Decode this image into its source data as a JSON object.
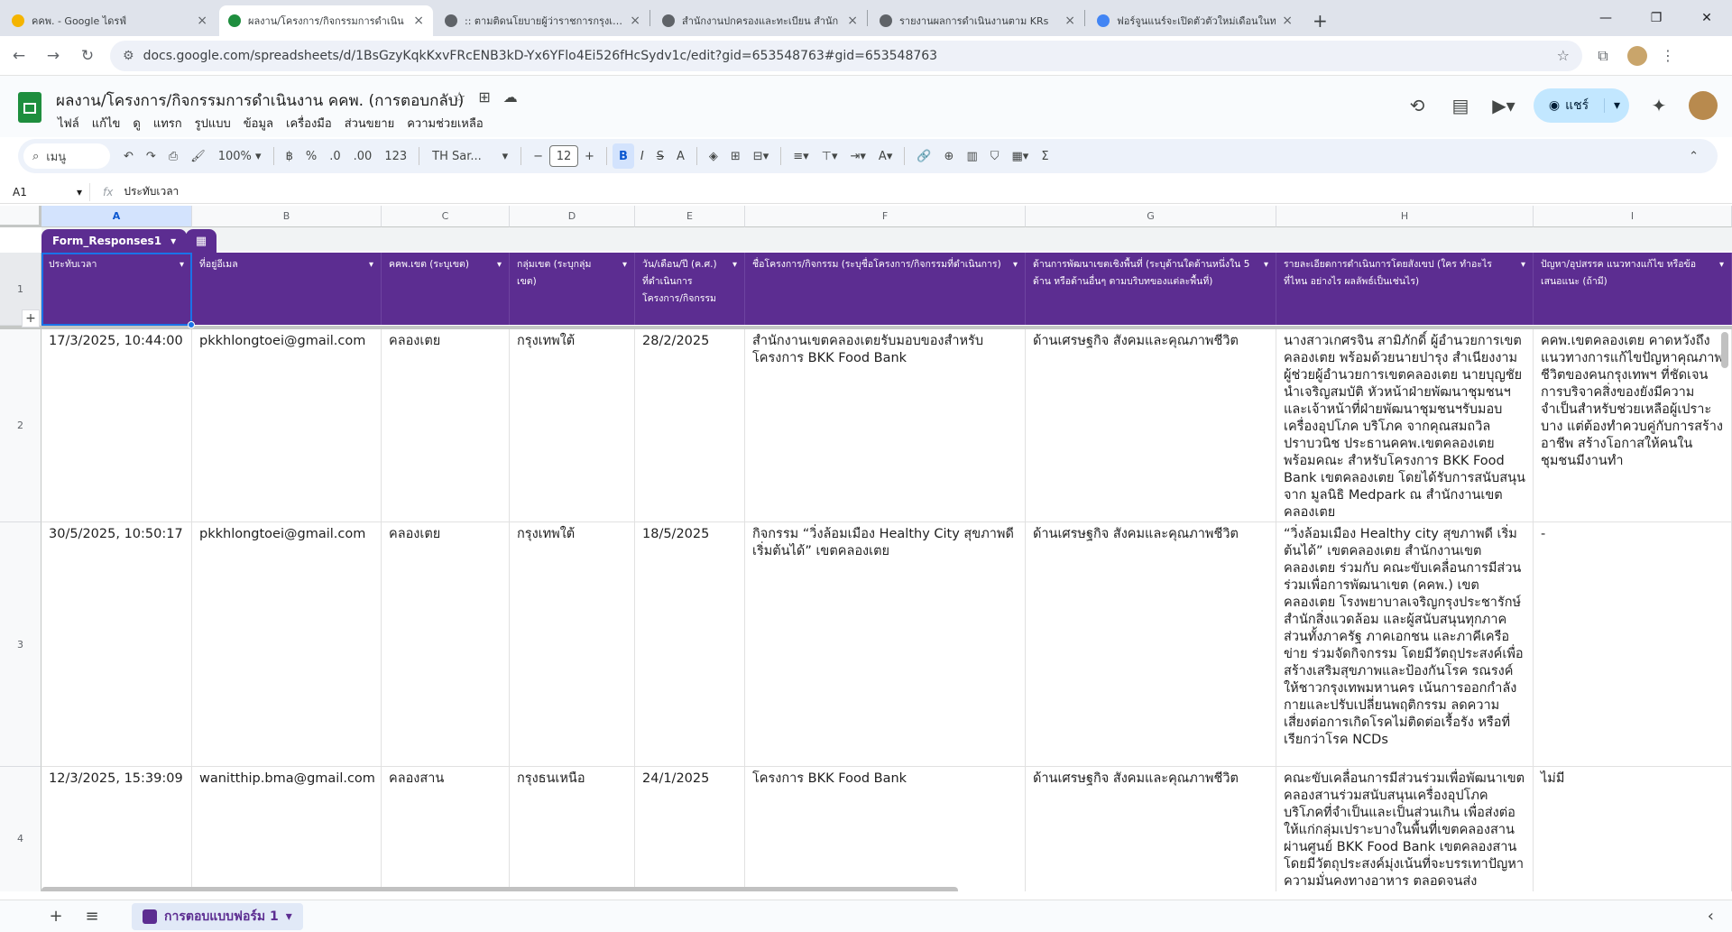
{
  "browser": {
    "tabs": [
      {
        "title": "คคพ. - Google ไดรฟ์",
        "color": "#f4b400"
      },
      {
        "title": "ผลงาน/โครงการ/กิจกรรมการดำเนิน",
        "color": "#1e8e3e"
      },
      {
        "title": ":: ตามติดนโยบายผู้ว่าราชการกรุงเทพ",
        "color": "#5f6368"
      },
      {
        "title": "สำนักงานปกครองและทะเบียน สำนัก",
        "color": "#5f6368"
      },
      {
        "title": "รายงานผลการดำเนินงานตาม KRs",
        "color": "#5f6368"
      },
      {
        "title": "ฟอร์จูนแนร์จะเปิดตัวตัวใหม่เดือนในท",
        "color": "#4285f4"
      }
    ],
    "url": "docs.google.com/spreadsheets/d/1BsGzyKqkKxvFRcENB3kD-Yx6YFlo4Ei526fHcSydv1c/edit?gid=653548763#gid=653548763"
  },
  "doc": {
    "title": "ผลงาน/โครงการ/กิจกรรมการดำเนินงาน คคพ. (การตอบกลับ)",
    "menu": [
      "ไฟล์",
      "แก้ไข",
      "ดู",
      "แทรก",
      "รูปแบบ",
      "ข้อมูล",
      "เครื่องมือ",
      "ส่วนขยาย",
      "ความช่วยเหลือ"
    ],
    "share_label": "แชร์"
  },
  "toolbar": {
    "search_label": "เมนู",
    "zoom": "100%",
    "pct": "%",
    "dec_less": ".0",
    "dec_more": ".00",
    "num_fmt": "123",
    "font": "TH Sar...",
    "font_size": "12"
  },
  "formula": {
    "cell_ref": "A1",
    "fx": "fx",
    "content": "ประทับเวลา"
  },
  "grid": {
    "columns": [
      "A",
      "B",
      "C",
      "D",
      "E",
      "F",
      "G",
      "H",
      "I"
    ],
    "table_name": "Form_Responses1",
    "headers": [
      "ประทับเวลา",
      "ที่อยู่อีเมล",
      "คคพ.เขต (ระบุเขต)",
      "กลุ่มเขต (ระบุกลุ่มเขต)",
      "วัน/เดือน/ปี (ค.ศ.) ที่ดำเนินการโครงการ/กิจกรรม",
      "ชื่อโครงการ/กิจกรรม (ระบุชื่อโครงการ/กิจกรรมที่ดำเนินการ)",
      "ด้านการพัฒนาเขตเชิงพื้นที่ (ระบุด้านใดด้านหนึ่งใน 5 ด้าน หรือด้านอื่นๆ ตามบริบทของแต่ละพื้นที่)",
      "รายละเอียดการดำเนินการโดยสังเขป (ใคร ทำอะไร ที่ไหน อย่างไร ผลลัพธ์เป็นเช่นไร)",
      "ปัญหา/อุปสรรค แนวทางแก้ไข หรือข้อเสนอแนะ (ถ้ามี)"
    ],
    "row_numbers": [
      "1",
      "2",
      "3",
      "4"
    ],
    "rows": [
      [
        "17/3/2025, 10:44:00",
        "pkkhlongtoei@gmail.com",
        "คลองเตย",
        "กรุงเทพใต้",
        "28/2/2025",
        "สำนักงานเขตคลองเตยรับมอบของสำหรับโครงการ BKK Food Bank",
        "ด้านเศรษฐกิจ สังคมและคุณภาพชีวิต",
        "นางสาวเกศรจิน สามิภักดิ์ ผู้อำนวยการเขตคลองเตย พร้อมด้วยนายปารุง สำเนียงงาม ผู้ช่วยผู้อำนวยการเขตคลองเตย นายบุญชัย นำเจริญสมบัติ หัวหน้าฝ่ายพัฒนาชุมชนฯ และเจ้าหน้าที่ฝ่ายพัฒนาชุมชนฯรับมอบเครื่องอุปโภค บริโภค จากคุณสมถวิล ปราบวนิช ประธานคคพ.เขตคลองเตยพร้อมคณะ สำหรับโครงการ BKK Food Bank เขตคลองเตย โดยได้รับการสนับสนุนจาก มูลนิธิ Medpark ณ สำนักงานเขตคลองเตย",
        "คคพ.เขตคลองเตย คาดหวังถึงแนวทางการแก้ไขปัญหาคุณภาพชีวิตของคนกรุงเทพฯ ที่ชัดเจน การบริจาคสิ่งของยังมีความจำเป็นสำหรับช่วยเหลือผู้เปราะบาง แต่ต้องทำควบคู่กับการสร้างอาชีพ สร้างโอกาสให้คนในชุมชนมีงานทำ"
      ],
      [
        "30/5/2025, 10:50:17",
        "pkkhlongtoei@gmail.com",
        "คลองเตย",
        "กรุงเทพใต้",
        "18/5/2025",
        "กิจกรรม “วิ่งล้อมเมือง Healthy City สุขภาพดีเริ่มต้นได้” เขตคลองเตย",
        "ด้านเศรษฐกิจ สังคมและคุณภาพชีวิต",
        "“วิ่งล้อมเมือง Healthy city สุขภาพดี เริ่มต้นได้” เขตคลองเตย สำนักงานเขตคลองเตย ร่วมกับ คณะขับเคลื่อนการมีส่วนร่วมเพื่อการพัฒนาเขต (คคพ.) เขตคลองเตย โรงพยาบาลเจริญกรุงประชารักษ์ สำนักสิ่งแวดล้อม และผู้สนับสนุนทุกภาคส่วนทั้งภาครัฐ ภาคเอกชน และภาคีเครือข่าย ร่วมจัดกิจกรรม โดยมีวัตถุประสงค์เพื่อสร้างเสริมสุขภาพและป้องกันโรค รณรงค์ให้ชาวกรุงเทพมหานคร เน้นการออกกำลังกายและปรับเปลี่ยนพฤติกรรม ลดความเสี่ยงต่อการเกิดโรคไม่ติดต่อเรื้อรัง หรือที่เรียกว่าโรค NCDs",
        "-"
      ],
      [
        "12/3/2025, 15:39:09",
        "wanitthip.bma@gmail.com",
        "คลองสาน",
        "กรุงธนเหนือ",
        "24/1/2025",
        "โครงการ BKK Food Bank",
        "ด้านเศรษฐกิจ สังคมและคุณภาพชีวิต",
        "คณะขับเคลื่อนการมีส่วนร่วมเพื่อพัฒนาเขตคลองสานร่วมสนับสนุนเครื่องอุปโภคบริโภคที่จำเป็นและเป็นส่วนเกิน เพื่อส่งต่อให้แก่กลุ่มเปราะบางในพื้นที่เขตคลองสาน ผ่านศูนย์ BKK Food Bank เขตคลองสาน โดยมีวัตถุประสงค์มุ่งเน้นที่จะบรรเทาปัญหาความมั่นคงทางอาหาร ตลอดจนส่ง",
        "ไม่มี"
      ]
    ]
  },
  "bottom": {
    "sheet_name": "การตอบแบบฟอร์ม 1"
  }
}
